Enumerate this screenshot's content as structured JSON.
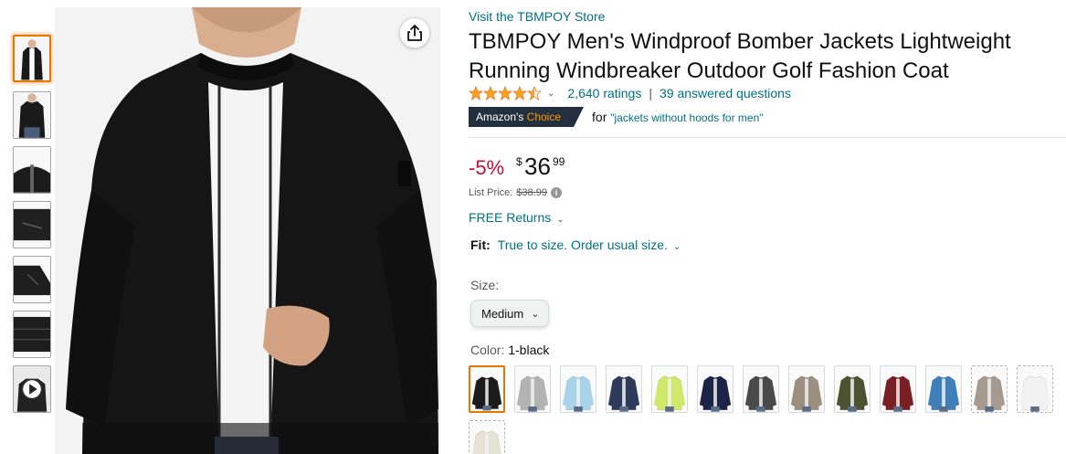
{
  "product": {
    "store_link": "Visit the TBMPOY Store",
    "title": "TBMPOY Men's Windproof Bomber Jackets Lightweight Running Windbreaker Outdoor Golf Fashion Coat",
    "rating_stars": 4.5,
    "ratings_count": "2,640 ratings",
    "answered_questions": "39 answered questions",
    "choice_badge": {
      "prefix": "Amazon's ",
      "highlight": "Choice"
    },
    "choice_for": "for",
    "choice_query": "\"jackets without hoods for men\""
  },
  "pricing": {
    "discount": "-5%",
    "currency_symbol": "$",
    "price_whole": "36",
    "price_fraction": "99",
    "list_price_label": "List Price:",
    "list_price": "$38.99"
  },
  "returns": {
    "label": "FREE Returns"
  },
  "fit": {
    "label": "Fit:",
    "value": "True to size. Order usual size."
  },
  "size": {
    "label": "Size:",
    "selected": "Medium"
  },
  "color": {
    "label": "Color: ",
    "selected": "1-black",
    "swatches": [
      {
        "name": "black",
        "color": "#1b1b1b"
      },
      {
        "name": "light-gray",
        "color": "#b3b3b3"
      },
      {
        "name": "light-blue",
        "color": "#a9d3ea"
      },
      {
        "name": "floral-navy",
        "color": "#2d3a5c"
      },
      {
        "name": "lime",
        "color": "#cfe86a"
      },
      {
        "name": "navy",
        "color": "#1d2447"
      },
      {
        "name": "dark-gray",
        "color": "#4a4a4a"
      },
      {
        "name": "khaki",
        "color": "#9c8f80"
      },
      {
        "name": "army-green",
        "color": "#4d5230"
      },
      {
        "name": "burgundy",
        "color": "#7a1f24"
      },
      {
        "name": "blue",
        "color": "#3f7fba"
      },
      {
        "name": "taupe",
        "color": "#a69a8f"
      },
      {
        "name": "white",
        "color": "#f2f2f2"
      },
      {
        "name": "cream",
        "color": "#e6e2d5"
      }
    ]
  },
  "thumbnails": [
    "front-view",
    "front-view-alt",
    "collar-detail",
    "pocket-detail",
    "sleeve-detail",
    "hem-detail",
    "video"
  ],
  "icons": {
    "share": "share-icon",
    "play": "play-icon",
    "info": "info-icon",
    "chevron": "chevron-down-icon"
  },
  "colors": {
    "link": "#007185",
    "discount": "#cc0c39",
    "badge_bg": "#232f3e",
    "badge_accent": "#ff9900",
    "star": "#ffa41c",
    "selected_border": "#e77600"
  }
}
